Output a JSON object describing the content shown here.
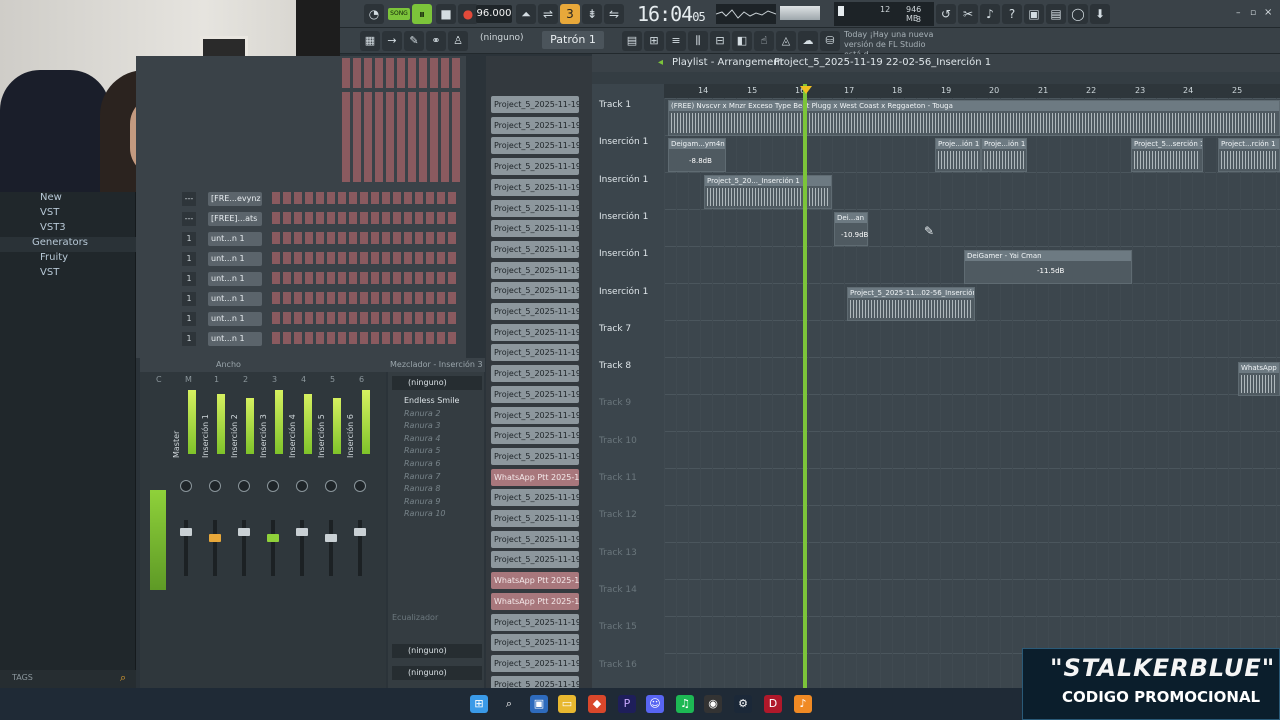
{
  "toolbar": {
    "tempo": "96.000",
    "clock_main": "16:04",
    "clock_sub": "05",
    "cpu_top": "12",
    "cpu_mem": "946 MB",
    "cpu_bottom": "3",
    "song_label": "SONG",
    "pattern": "Patrón 1",
    "channel_none": "(ninguno)",
    "hint_line1": "Today  ¡Hay una nueva",
    "hint_line2": "versión de FL Studio está d..."
  },
  "playlist": {
    "title": "Playlist - Arrangement",
    "breadcrumb": "Project_5_2025-11-19 22-02-56_Inserción 1",
    "ruler": [
      "14",
      "15",
      "16",
      "17",
      "18",
      "19",
      "20",
      "21",
      "22",
      "23",
      "24",
      "25"
    ],
    "tracks": [
      {
        "label": "Track 1",
        "dim": false
      },
      {
        "label": "Inserción 1",
        "dim": false
      },
      {
        "label": "Inserción 1",
        "dim": false
      },
      {
        "label": "Inserción 1",
        "dim": false
      },
      {
        "label": "Inserción 1",
        "dim": false
      },
      {
        "label": "Inserción 1",
        "dim": false
      },
      {
        "label": "Track 7",
        "dim": false
      },
      {
        "label": "Track 8",
        "dim": false
      },
      {
        "label": "Track 9",
        "dim": true
      },
      {
        "label": "Track 10",
        "dim": true
      },
      {
        "label": "Track 11",
        "dim": true
      },
      {
        "label": "Track 12",
        "dim": true
      },
      {
        "label": "Track 13",
        "dim": true
      },
      {
        "label": "Track 14",
        "dim": true
      },
      {
        "label": "Track 15",
        "dim": true
      },
      {
        "label": "Track 16",
        "dim": true
      }
    ],
    "clips": {
      "main": "(FREE) Nvscvr x Mnzr Exceso Type Beat  Plugg x West Coast x Reggaeton - Tougа",
      "c1": "Deigam...ym4n",
      "c1db": "-8.8dB",
      "c2": "Proje...ión 1",
      "c3": "Proje...ión 1",
      "c4": "Project_5...serción 1",
      "c5": "Project...rción 1",
      "c6": "Project_5_20..._Inserción 1",
      "c7": "Dei...an",
      "c7db": "-10.9dB",
      "c8": "DeiGamer - Yai Cman",
      "c8db": "-11.5dB",
      "c9": "Project_5_2025-11...02-56_Inserción 1",
      "c10": "WhatsApp"
    }
  },
  "patterns": [
    "Project_5_2025-11-19 2...",
    "Project_5_2025-11-19 2...",
    "Project_5_2025-11-19 2...",
    "Project_5_2025-11-19 2...",
    "Project_5_2025-11-19 2...",
    "Project_5_2025-11-19 2...",
    "Project_5_2025-11-19 2...",
    "Project_5_2025-11-19 2...",
    "Project_5_2025-11-19 2...",
    "Project_5_2025-11-19 2...",
    "Project_5_2025-11-19 2...",
    "Project_5_2025-11-19 2...",
    "Project_5_2025-11-19 2...",
    "Project_5_2025-11-19 2...",
    "Project_5_2025-11-19 2...",
    "Project_5_2025-11-19 2...",
    "Project_5_2025-11-19 2...",
    "Project_5_2025-11-19 2...",
    "WhatsApp Ptt 2025-11-...",
    "Project_5_2025-11-19 2...",
    "Project_5_2025-11-19 2...",
    "Project_5_2025-11-19 2...",
    "Project_5_2025-11-19 2...",
    "WhatsApp Ptt 2025-1...",
    "WhatsApp Ptt 2025-1...",
    "Project_5_2025-11-19 2...",
    "Project_5_2025-11-19 2...",
    "Project_5_2025-11-19 2...",
    "Project_5_2025-11-19 2...",
    "Project_5_2025-11-19 2..."
  ],
  "browser": {
    "items": [
      {
        "label": "New",
        "indent": true
      },
      {
        "label": "VST",
        "indent": true
      },
      {
        "label": "VST3",
        "indent": true
      },
      {
        "label": "Generators",
        "indent": false
      },
      {
        "label": "Fruity",
        "indent": true
      },
      {
        "label": "VST",
        "indent": true
      }
    ],
    "tags": "TAGS"
  },
  "rack": {
    "rows": [
      {
        "num": "---",
        "name": "[FRE...evynz"
      },
      {
        "num": "---",
        "name": "[FREE]...ats"
      },
      {
        "num": "1",
        "name": "unt...n 1"
      },
      {
        "num": "1",
        "name": "unt...n 1"
      },
      {
        "num": "1",
        "name": "unt...n 1"
      },
      {
        "num": "1",
        "name": "unt...n 1"
      },
      {
        "num": "1",
        "name": "unt...n 1"
      },
      {
        "num": "1",
        "name": "unt...n 1"
      }
    ]
  },
  "mixer": {
    "header_left": "Ancho",
    "header_right": "Mezclador - Inserción 3",
    "channel_letters": [
      "C",
      "M",
      "1",
      "2",
      "3",
      "4",
      "5",
      "6"
    ],
    "strips": [
      "Master",
      "Inserción 1",
      "Inserción 2",
      "Inserción 3",
      "Inserción 4",
      "Inserción 5",
      "Inserción 6"
    ],
    "slots_head": "(ninguno)",
    "slots": [
      "Endless Smile",
      "Ranura 2",
      "Ranura 3",
      "Ranura 4",
      "Ranura 5",
      "Ranura 6",
      "Ranura 7",
      "Ranura 8",
      "Ranura 9",
      "Ranura 10"
    ],
    "eq": "Ecualizador",
    "out1": "(ninguno)",
    "out2": "(ninguno)"
  },
  "promo": {
    "name": "\"STALKERBLUE\"",
    "sub": "CODIGO PROMOCIONAL"
  }
}
